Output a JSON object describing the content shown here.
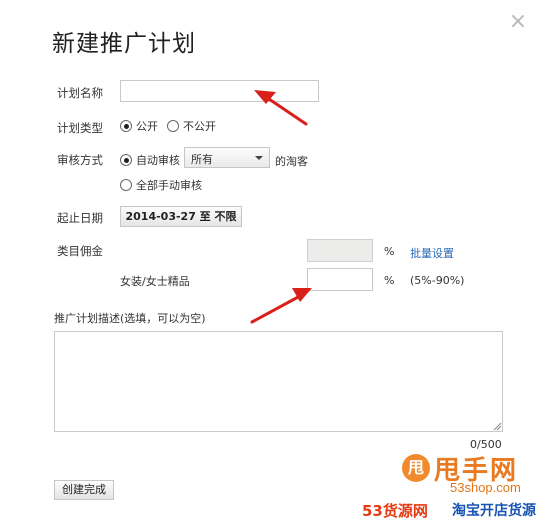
{
  "dialog": {
    "title": "新建推广计划",
    "close_glyph": "×"
  },
  "form": {
    "plan_name": {
      "label": "计划名称",
      "value": "",
      "placeholder": ""
    },
    "plan_type": {
      "label": "计划类型",
      "options": [
        {
          "label": "公开",
          "checked": true
        },
        {
          "label": "不公开",
          "checked": false
        }
      ]
    },
    "review": {
      "label": "审核方式",
      "auto_label": "自动审核",
      "auto_checked": true,
      "select_value": "所有",
      "suffix": "的淘客",
      "manual_label": "全部手动审核",
      "manual_checked": false
    },
    "date": {
      "label": "起止日期",
      "value": "2014-03-27 至 不限"
    },
    "commission": {
      "label": "类目佣金",
      "percent": "%",
      "batch_link": "批量设置",
      "category_label": "女装/女士精品",
      "category_value": "",
      "range_hint": "(5%-90%)"
    },
    "description": {
      "label": "推广计划描述(选填，可以为空)",
      "value": "",
      "counter": "0/500"
    },
    "submit_label": "创建完成"
  },
  "watermark": {
    "circle": "甩",
    "big": "甩手网",
    "url": "53shop.com",
    "bottom_left": "53货源网",
    "bottom_right": "淘宝开店货源"
  },
  "colors": {
    "annotation_arrow": "#d9201a",
    "link": "#2a6bb8",
    "watermark_orange": "#e97a20"
  }
}
